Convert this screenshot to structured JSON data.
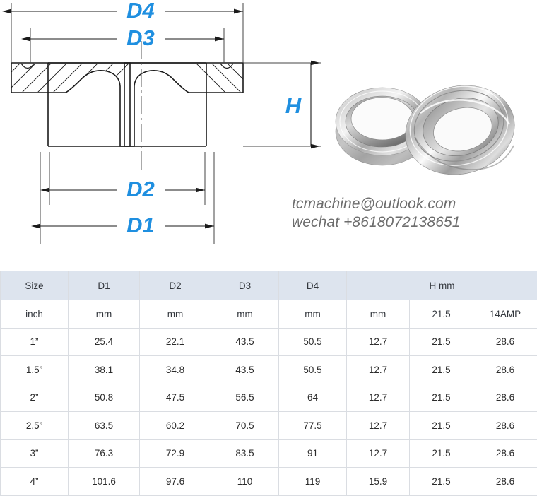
{
  "drawing": {
    "title": "Tri-clamp ferrule cross-section dimension drawing",
    "accent_color": "#1f8fe0",
    "line_color": "#1a1a1a",
    "labels": {
      "d4": "D4",
      "d3": "D3",
      "d2": "D2",
      "d1": "D1",
      "h": "H"
    }
  },
  "photo": {
    "alt": "Two stainless steel tri-clamp ferrules overlapping",
    "metal_light": "#f2f2f2",
    "metal_mid": "#bdbdbd",
    "metal_dark": "#7d7d7d"
  },
  "contact": {
    "email": "tcmachine@outlook.com",
    "wechat": "wechat +8618072138651",
    "text_color": "#6d6d6d"
  },
  "table": {
    "header_bg": "#dde4ee",
    "border_color": "#dadde2",
    "group_headers": [
      {
        "label": "Size",
        "colspan": 1,
        "rowspan": 1
      },
      {
        "label": "D1",
        "colspan": 1,
        "rowspan": 1
      },
      {
        "label": "D2",
        "colspan": 1,
        "rowspan": 1
      },
      {
        "label": "D3",
        "colspan": 1,
        "rowspan": 1
      },
      {
        "label": "D4",
        "colspan": 1,
        "rowspan": 1
      },
      {
        "label": "H mm",
        "colspan": 3,
        "rowspan": 1
      }
    ],
    "units_row": [
      "inch",
      "mm",
      "mm",
      "mm",
      "mm",
      "mm",
      "21.5",
      "14AMP"
    ],
    "rows": [
      [
        "1”",
        "25.4",
        "22.1",
        "43.5",
        "50.5",
        "12.7",
        "21.5",
        "28.6"
      ],
      [
        "1.5”",
        "38.1",
        "34.8",
        "43.5",
        "50.5",
        "12.7",
        "21.5",
        "28.6"
      ],
      [
        "2”",
        "50.8",
        "47.5",
        "56.5",
        "64",
        "12.7",
        "21.5",
        "28.6"
      ],
      [
        "2.5”",
        "63.5",
        "60.2",
        "70.5",
        "77.5",
        "12.7",
        "21.5",
        "28.6"
      ],
      [
        "3”",
        "76.3",
        "72.9",
        "83.5",
        "91",
        "12.7",
        "21.5",
        "28.6"
      ],
      [
        "4”",
        "101.6",
        "97.6",
        "110",
        "119",
        "15.9",
        "21.5",
        "28.6"
      ]
    ]
  }
}
